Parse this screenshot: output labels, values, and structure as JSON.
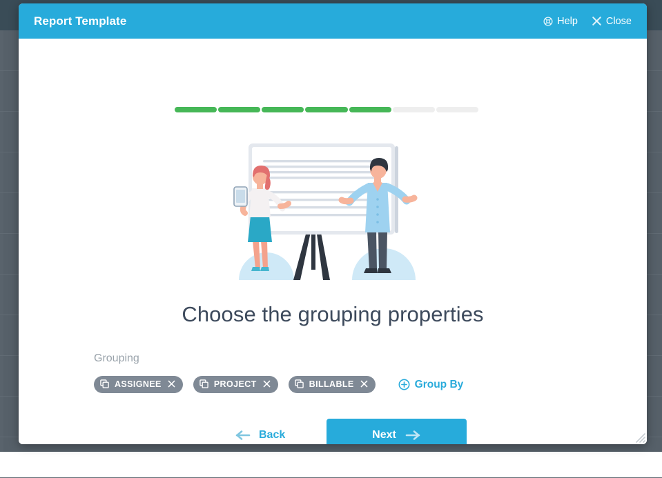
{
  "backdrop": {
    "row_count": 11,
    "search_icon": "search-icon",
    "overlay_color": "#566069",
    "topbar_color": "#3a4c57"
  },
  "modal": {
    "title": "Report Template",
    "header_color": "#27abdb",
    "help": {
      "label": "Help",
      "icon": "lifebuoy-icon"
    },
    "close": {
      "label": "Close",
      "icon": "close-x-icon"
    },
    "resize_handle_icon": "resize-grip-icon"
  },
  "progress": {
    "total_steps": 7,
    "completed_steps": 5,
    "fill_color": "#46b757",
    "track_color": "#eeeeee"
  },
  "illustration": {
    "name": "presentation-whiteboard-illustration",
    "alt": "Two people presenting at a flipchart on a tripod"
  },
  "step": {
    "heading": "Choose the grouping properties"
  },
  "grouping": {
    "label": "Grouping",
    "chips": [
      {
        "label": "ASSIGNEE",
        "icon": "copy-icon",
        "remove_icon": "close-x-icon"
      },
      {
        "label": "PROJECT",
        "icon": "copy-icon",
        "remove_icon": "close-x-icon"
      },
      {
        "label": "BILLABLE",
        "icon": "copy-icon",
        "remove_icon": "close-x-icon"
      }
    ],
    "add_link": {
      "label": "Group By",
      "icon": "plus-circle-icon",
      "color": "#29abdb"
    }
  },
  "footer": {
    "back": {
      "label": "Back",
      "icon": "arrow-left-icon"
    },
    "next": {
      "label": "Next",
      "icon": "arrow-right-icon",
      "color": "#27abdb"
    }
  }
}
